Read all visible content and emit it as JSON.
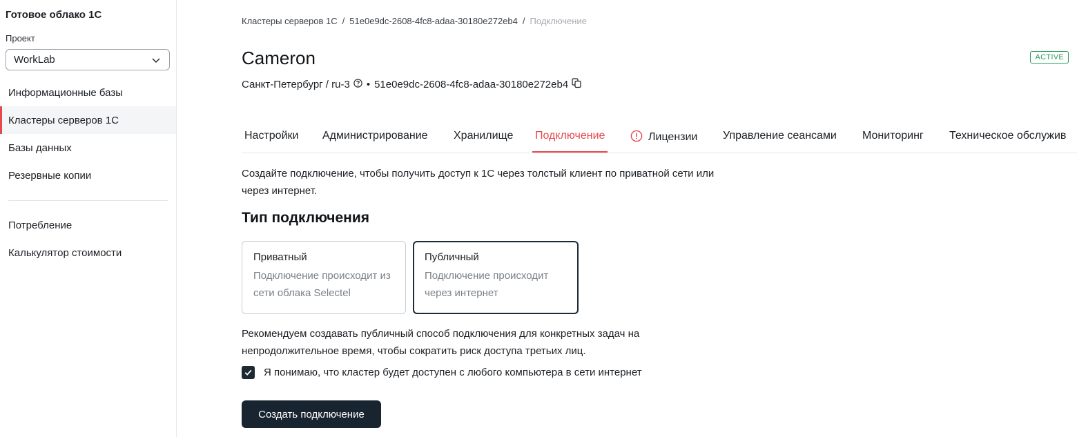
{
  "sidebar": {
    "brand": "Готовое облако 1С",
    "project_label": "Проект",
    "project_value": "WorkLab",
    "items": [
      {
        "label": "Информационные базы"
      },
      {
        "label": "Кластеры серверов 1С"
      },
      {
        "label": "Базы данных"
      },
      {
        "label": "Резервные копии"
      },
      {
        "label": "Потребление"
      },
      {
        "label": "Калькулятор стоимости"
      }
    ],
    "active_item": "Кластеры серверов 1С"
  },
  "breadcrumb": {
    "items": [
      "Кластеры серверов 1С",
      "51e0e9dc-2608-4fc8-adaa-30180e272eb4",
      "Подключение"
    ],
    "separator": "/"
  },
  "header": {
    "title": "Cameron",
    "status": "ACTIVE",
    "region": "Санкт-Петербург / ru-3",
    "dot": "•",
    "cluster_id": "51e0e9dc-2608-4fc8-adaa-30180e272eb4"
  },
  "tabs": [
    {
      "label": "Настройки"
    },
    {
      "label": "Администрирование"
    },
    {
      "label": "Хранилище"
    },
    {
      "label": "Подключение"
    },
    {
      "label": "Лицензии"
    },
    {
      "label": "Управление сеансами"
    },
    {
      "label": "Мониторинг"
    },
    {
      "label": "Техническое обслужив"
    }
  ],
  "active_tab": "Подключение",
  "content": {
    "intro": "Создайте подключение, чтобы получить доступ к 1С через толстый клиент по приватной сети или через интернет.",
    "section_title": "Тип подключения",
    "options": [
      {
        "title": "Приватный",
        "description": "Подключение происходит из сети облака Selectel",
        "selected": false
      },
      {
        "title": "Публичный",
        "description": "Подключение происходит через интернет",
        "selected": true
      }
    ],
    "recommendation": "Рекомендуем создавать публичный способ подключения для конкретных задач на непродолжительное время, чтобы сократить риск доступа третьих лиц.",
    "consent_label": "Я понимаю, что кластер будет доступен с любого компьютера в сети интернет",
    "consent_checked": true,
    "submit_label": "Создать подключение"
  },
  "colors": {
    "accent": "#e5484d",
    "status_active": "#2e9b5a",
    "primary_button": "#182530"
  },
  "icons": {
    "project_select": "chevron-down-icon",
    "region_help": "help-circle-icon",
    "copy_id": "copy-icon",
    "license_warning": "alert-circle-icon",
    "consent": "check-icon"
  }
}
